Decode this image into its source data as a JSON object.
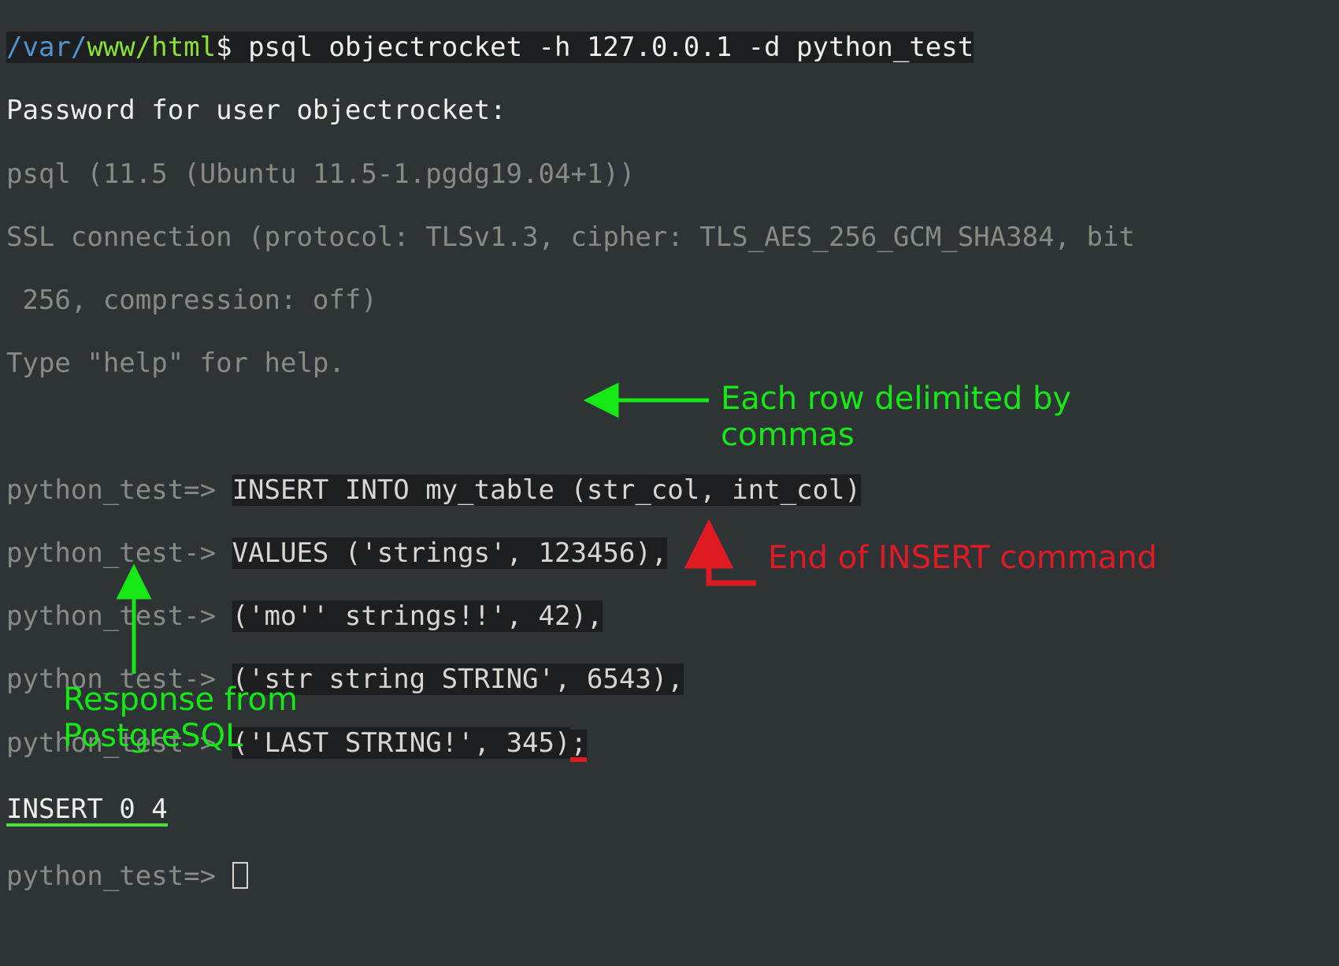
{
  "prompt": {
    "cwd_blue": "/var/",
    "cwd_green": "www/html",
    "dollar": "$",
    "command": " psql objectrocket -h 127.0.0.1 -d python_test"
  },
  "lines": {
    "password": "Password for user objectrocket:",
    "version": "psql (11.5 (Ubuntu 11.5-1.pgdg19.04+1))",
    "ssl1": "SSL connection (protocol: TLSv1.3, cipher: TLS_AES_256_GCM_SHA384, bit",
    "ssl2": " 256, compression: off)",
    "help": "Type \"help\" for help.",
    "blank1": "",
    "p1_prompt": "python_test=> ",
    "p1_cmd": "INSERT INTO my_table (str_col, int_col)",
    "p2_prompt": "python_test-> ",
    "p2_cmd": "VALUES ('strings', 123456),",
    "p3_prompt": "python_test-> ",
    "p3_cmd": "('mo'' strings!!', 42)",
    "p3_comma": ",",
    "p4_prompt": "python_test-> ",
    "p4_cmd": "('str string STRING', 6543),",
    "p5_prompt": "python_test-> ",
    "p5_cmd": "('LAST STRING!', 345)",
    "p5_semi": ";",
    "insert_result": "INSERT 0 4",
    "last_prompt": "python_test=> "
  },
  "annotations": {
    "row_delim": "Each row delimited by commas",
    "response": "Response from PostgreSQL",
    "end_cmd": "End of INSERT command"
  }
}
